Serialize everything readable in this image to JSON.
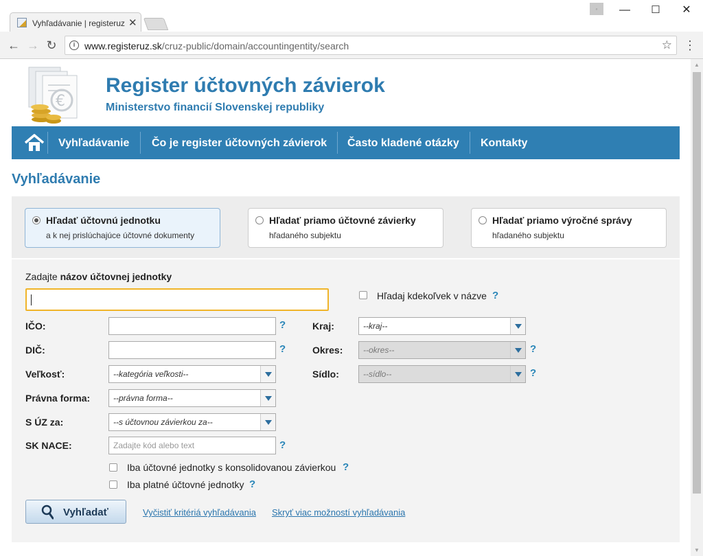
{
  "browser": {
    "tab_title": "Vyhľadávanie | registeruz",
    "url_host": "www.registeruz.sk",
    "url_path": "/cruz-public/domain/accountingentity/search"
  },
  "site": {
    "title": "Register účtovných závierok",
    "subtitle": "Ministerstvo financií Slovenskej republiky"
  },
  "nav": {
    "items": [
      "Vyhľadávanie",
      "Čo je register účtovných závierok",
      "Často kladené otázky",
      "Kontakty"
    ]
  },
  "page": {
    "heading": "Vyhľadávanie"
  },
  "modes": [
    {
      "title": "Hľadať účtovnú jednotku",
      "subtitle": "a k nej prislúchajúce účtovné dokumenty",
      "selected": true
    },
    {
      "title": "Hľadať priamo účtovné závierky",
      "subtitle": "hľadaného subjektu",
      "selected": false
    },
    {
      "title": "Hľadať priamo výročné správy",
      "subtitle": "hľadaného subjektu",
      "selected": false
    }
  ],
  "form": {
    "name_prompt_prefix": "Zadajte",
    "name_prompt_bold": "názov účtovnej jednotky",
    "name_value": "",
    "anywhere_label": "Hľadaj kdekoľvek v názve",
    "ico_label": "IČO:",
    "dic_label": "DIČ:",
    "size_label": "Veľkosť:",
    "size_value": "--kategória veľkosti--",
    "legal_form_label": "Právna forma:",
    "legal_form_value": "--právna forma--",
    "suz_label": "S ÚZ za:",
    "suz_value": "--s účtovnou závierkou za--",
    "nace_label": "SK NACE:",
    "nace_placeholder": "Zadajte kód alebo text",
    "region_label": "Kraj:",
    "region_value": "--kraj--",
    "district_label": "Okres:",
    "district_value": "--okres--",
    "seat_label": "Sídlo:",
    "seat_value": "--sídlo--",
    "consolidated_label": "Iba účtovné jednotky s konsolidovanou závierkou",
    "valid_label": "Iba platné účtovné jednotky",
    "help_symbol": "?",
    "search_button": "Vyhľadať",
    "clear_link": "Vyčistiť kritériá vyhľadávania",
    "hide_link": "Skryť viac možností vyhľadávania"
  },
  "colors": {
    "brand": "#2f7fb3",
    "focus": "#f0b429"
  }
}
